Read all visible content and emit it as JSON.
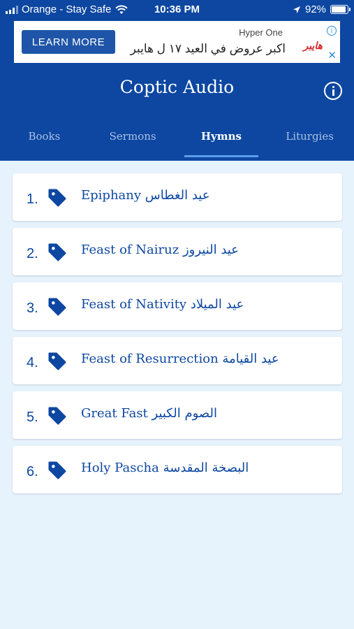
{
  "status_bar": {
    "carrier": "Orange - Stay Safe",
    "time": "10:36 PM",
    "battery": "92%"
  },
  "ad": {
    "button_label": "LEARN MORE",
    "brand": "Hyper One",
    "text": "اكبر عروض في العيد ١٧ ل هايبر",
    "logo_text": "هايبر"
  },
  "header": {
    "title": "Coptic Audio"
  },
  "tabs": [
    {
      "label": "Books"
    },
    {
      "label": "Sermons"
    },
    {
      "label": "Hymns"
    },
    {
      "label": "Liturgies"
    }
  ],
  "active_tab": "Hymns",
  "hymns": [
    {
      "number": "1.",
      "label": "Epiphany عيد الغطاس"
    },
    {
      "number": "2.",
      "label": "Feast of Nairuz عيد النيروز"
    },
    {
      "number": "3.",
      "label": "Feast of Nativity عيد الميلاد"
    },
    {
      "number": "4.",
      "label": "Feast of Resurrection عيد القيامة"
    },
    {
      "number": "5.",
      "label": "Great Fast الصوم الكبير"
    },
    {
      "number": "6.",
      "label": "Holy Pascha البصخة المقدسة"
    }
  ],
  "colors": {
    "primary": "#0d47a1",
    "background": "#e6f2fc",
    "tab_indicator": "#5d9cec"
  }
}
